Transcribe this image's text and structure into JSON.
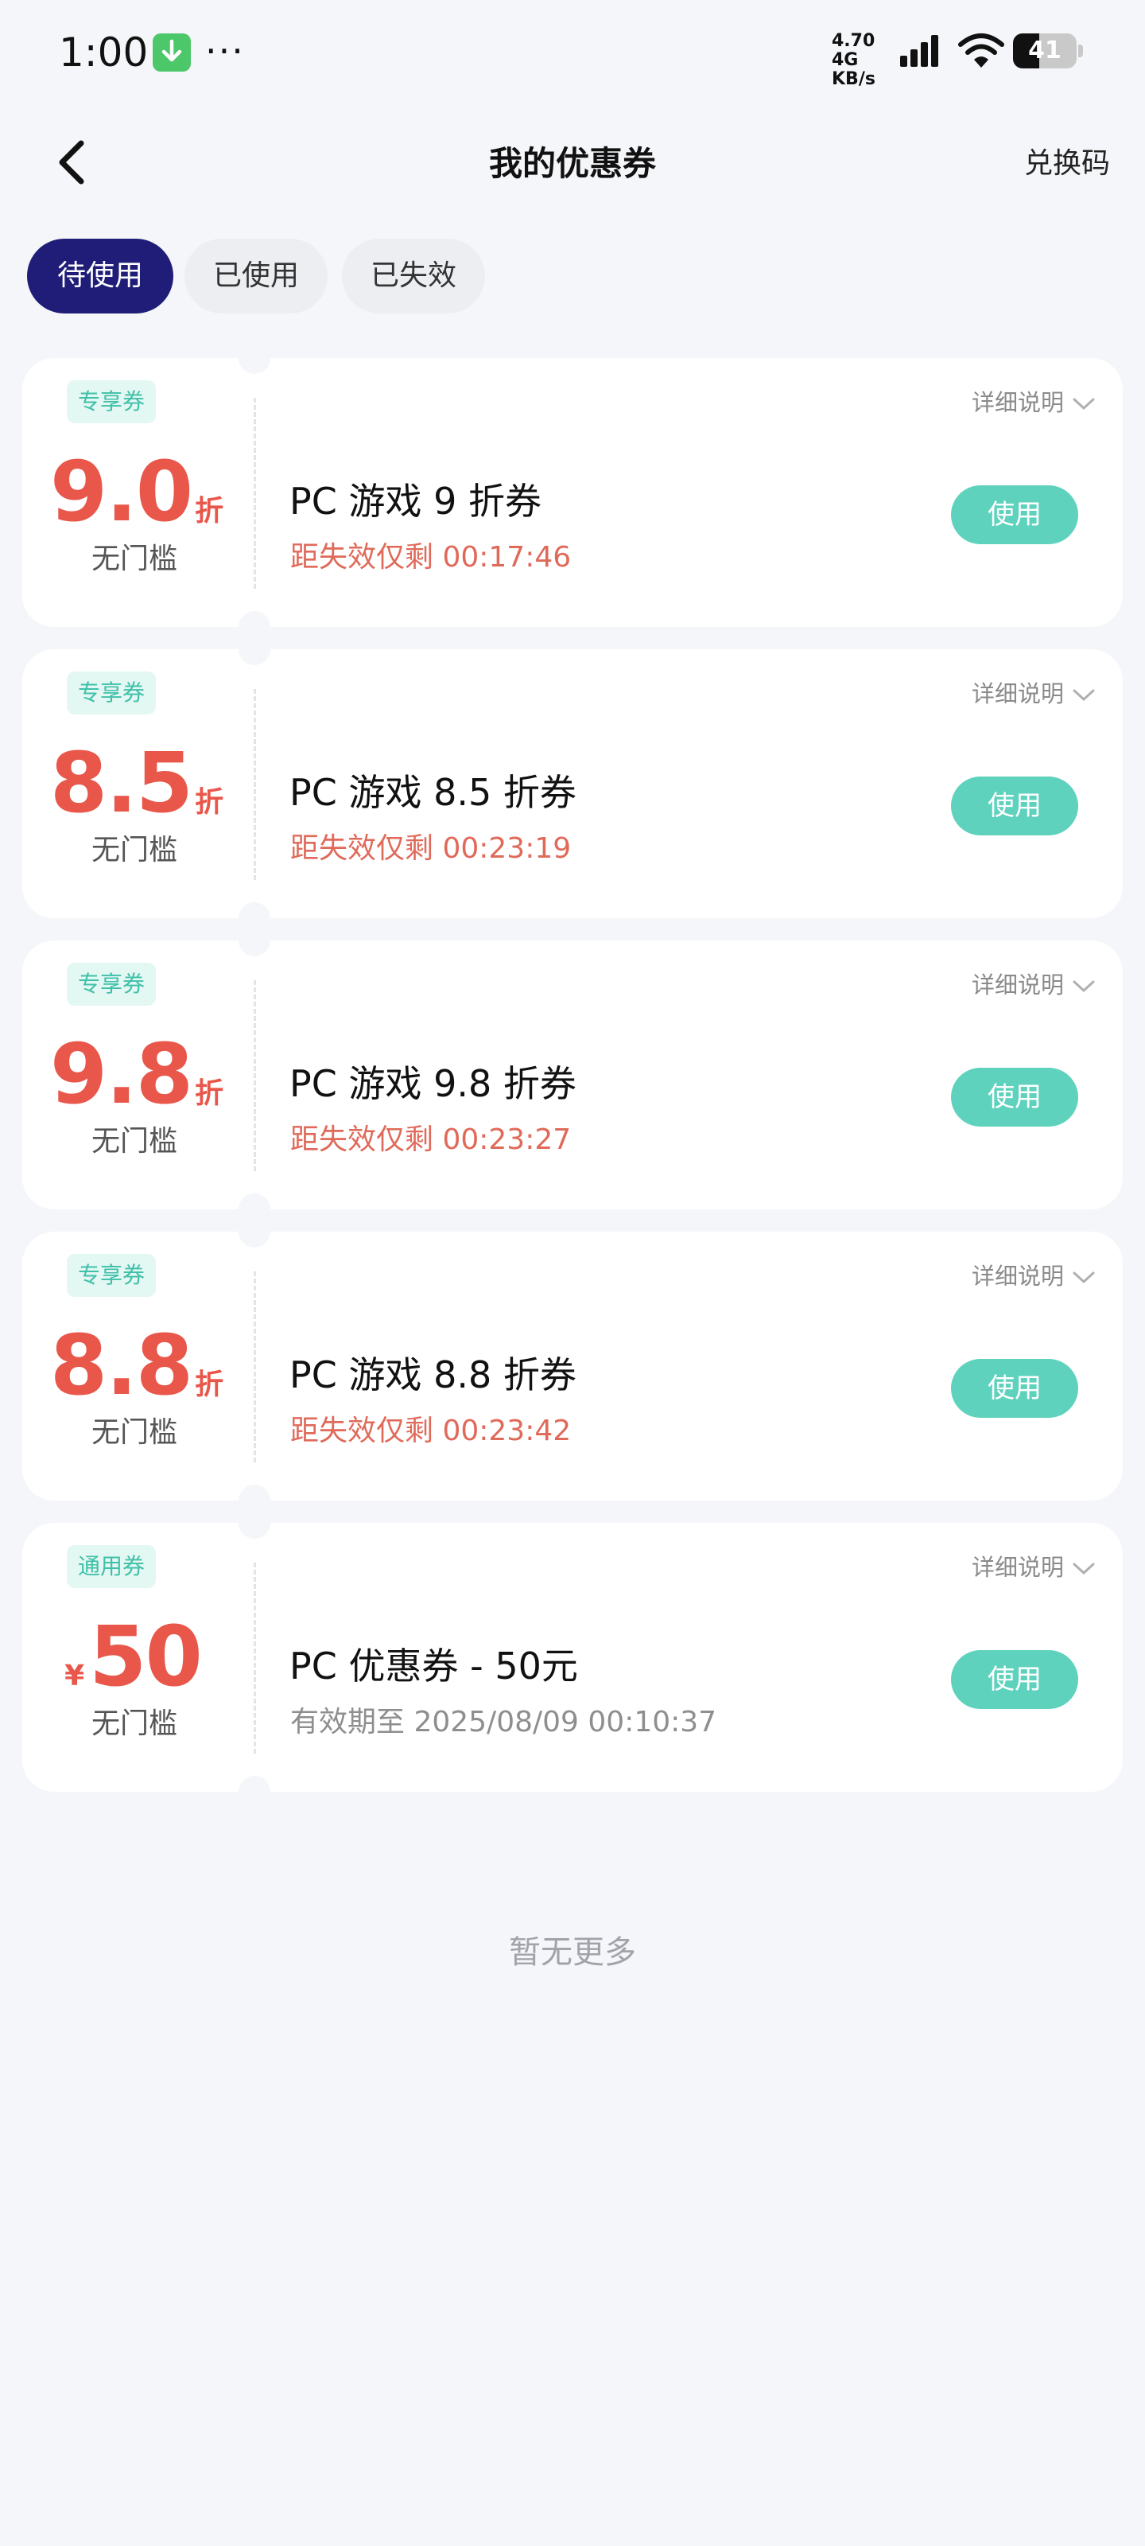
{
  "status_bar": {
    "time": "1:00",
    "more": "···",
    "net_speed_line1": "4.70 4G",
    "net_speed_line2": "KB/s",
    "battery": "41",
    "battery_level": 0.41
  },
  "nav": {
    "title": "我的优惠券",
    "action": "兑换码"
  },
  "tabs": [
    {
      "label": "待使用",
      "active": true
    },
    {
      "label": "已使用",
      "active": false
    },
    {
      "label": "已失效",
      "active": false
    }
  ],
  "coupons": [
    {
      "tag": "专享券",
      "value": "9.0",
      "unit": "折",
      "currency": "",
      "threshold": "无门槛",
      "name": "PC 游戏 9 折券",
      "expire": "距失效仅剩 00:17:46",
      "detail": "详细说明",
      "button": "使用"
    },
    {
      "tag": "专享券",
      "value": "8.5",
      "unit": "折",
      "currency": "",
      "threshold": "无门槛",
      "name": "PC 游戏 8.5 折券",
      "expire": "距失效仅剩 00:23:19",
      "detail": "详细说明",
      "button": "使用"
    },
    {
      "tag": "专享券",
      "value": "9.8",
      "unit": "折",
      "currency": "",
      "threshold": "无门槛",
      "name": "PC 游戏 9.8 折券",
      "expire": "距失效仅剩 00:23:27",
      "detail": "详细说明",
      "button": "使用"
    },
    {
      "tag": "专享券",
      "value": "8.8",
      "unit": "折",
      "currency": "",
      "threshold": "无门槛",
      "name": "PC 游戏 8.8 折券",
      "expire": "距失效仅剩 00:23:42",
      "detail": "详细说明",
      "button": "使用"
    },
    {
      "tag": "通用券",
      "value": "50",
      "unit": "",
      "currency": "¥",
      "threshold": "无门槛",
      "name": "PC 优惠券 - 50元",
      "expire": "有效期至 2025/08/09 00:10:37",
      "detail": "详细说明",
      "button": "使用"
    }
  ],
  "footer": {
    "no_more": "暂无更多"
  },
  "colors": {
    "accent_tab": "#1f1d78",
    "value_red": "#e9574b",
    "expire_red": "#e06a5a",
    "use_button": "#5fd2be",
    "tag_text": "#3fc0a8",
    "tag_bg": "#e3f7f3",
    "background": "#f5f6f9"
  },
  "icons": [
    "download-icon",
    "signal-icon",
    "wifi-icon",
    "battery-icon",
    "back-arrow-icon",
    "chevron-down-icon"
  ]
}
